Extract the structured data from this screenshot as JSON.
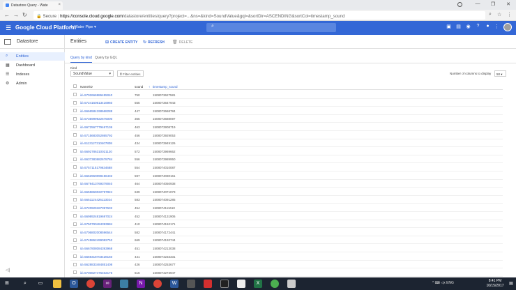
{
  "browser": {
    "tab_title": "Datastore Query - Wate",
    "tab_close": "×",
    "window_controls": [
      "—",
      "❐",
      "✕"
    ],
    "url_secure": "Secure",
    "url_host": "https://console.cloud.google.com",
    "url_path": "/datastore/entities/query?project=...&ns=&kind=SoundValue&gql=&sortDir=ASCENDING&sortCol=timestamp_sound"
  },
  "header": {
    "app_title": "Google Cloud Platform",
    "project": "Water Pipe ▾"
  },
  "sidebar": {
    "brand": "Datastore",
    "items": [
      {
        "label": "Entities",
        "icon": "search-icon",
        "glyph": "⌕",
        "active": true
      },
      {
        "label": "Dashboard",
        "icon": "dashboard-icon",
        "glyph": "▦",
        "active": false
      },
      {
        "label": "Indexes",
        "icon": "index-icon",
        "glyph": "☰",
        "active": false
      },
      {
        "label": "Admin",
        "icon": "gear-icon",
        "glyph": "⚙",
        "active": false
      }
    ],
    "collapse": "◁|"
  },
  "main": {
    "title": "Entities",
    "actions": {
      "create": "CREATE ENTITY",
      "refresh": "REFRESH",
      "delete": "DELETE"
    },
    "tabs": [
      "Query by kind",
      "Query by GQL"
    ],
    "kind_label": "Kind",
    "kind_value": "SoundValue",
    "filter_label": "Filter entities",
    "cols_label": "Number of columns to display",
    "cols_value": "50 ▾"
  },
  "table": {
    "headers": [
      "Name/ID",
      "sound",
      "timestamp_sound"
    ],
    "sort_arrow": "↑",
    "rows": [
      {
        "id": "id=5702666986455040",
        "sound": "750",
        "ts": "1508073627581"
      },
      {
        "id": "id=5724160613416960",
        "sound": "555",
        "ts": "1508073647943"
      },
      {
        "id": "id=5666584198668288",
        "sound": "447",
        "ts": "1508073668784"
      },
      {
        "id": "id=5735999922675000",
        "sound": "365",
        "ts": "1508073688097"
      },
      {
        "id": "id=5672567779467136",
        "sound": "463",
        "ts": "1508073908719"
      },
      {
        "id": "id=5715683052865792",
        "sound": "456",
        "ts": "1508073929053"
      },
      {
        "id": "id=5113127310407808",
        "sound": "434",
        "ts": "1508073949126"
      },
      {
        "id": "id=5692786310021120",
        "sound": "572",
        "ts": "1508073969662"
      },
      {
        "id": "id=5637383682678784",
        "sound": "556",
        "ts": "1508073989950"
      },
      {
        "id": "id=5757115179634688",
        "sound": "554",
        "ts": "1508074010087"
      },
      {
        "id": "id=5662960099196432",
        "sound": "597",
        "ts": "1508074030161"
      },
      {
        "id": "id=5679413769379040",
        "sound": "464",
        "ts": "1508074050938"
      },
      {
        "id": "id=5655869022797824",
        "sound": "639",
        "ts": "1508074071073"
      },
      {
        "id": "id=5651124426113024",
        "sound": "583",
        "ts": "1508074091285"
      },
      {
        "id": "id=5720929187397632",
        "sound": "454",
        "ts": "1508074111610"
      },
      {
        "id": "id=5698924819697024",
        "sound": "452",
        "ts": "1508074131906"
      },
      {
        "id": "id=5750790484393984",
        "sound": "410",
        "ts": "1508074152171"
      },
      {
        "id": "id=5706802008596544",
        "sound": "582",
        "ts": "1508074172441"
      },
      {
        "id": "id=5745862499082752",
        "sound": "669",
        "ts": "1508074192744"
      },
      {
        "id": "id=5667808084393968",
        "sound": "451",
        "ts": "1508074213038"
      },
      {
        "id": "id=5659318703428160",
        "sound": "441",
        "ts": "1508074233331"
      },
      {
        "id": "id=5628833484851408",
        "sound": "426",
        "ts": "1508074253677"
      },
      {
        "id": "id=5700827476402176",
        "sound": "516",
        "ts": "1508074273947"
      }
    ]
  },
  "taskbar": {
    "tray": "^ ⌨ ◁x ENG",
    "time": "8:41 PM",
    "date": "10/15/2017"
  }
}
